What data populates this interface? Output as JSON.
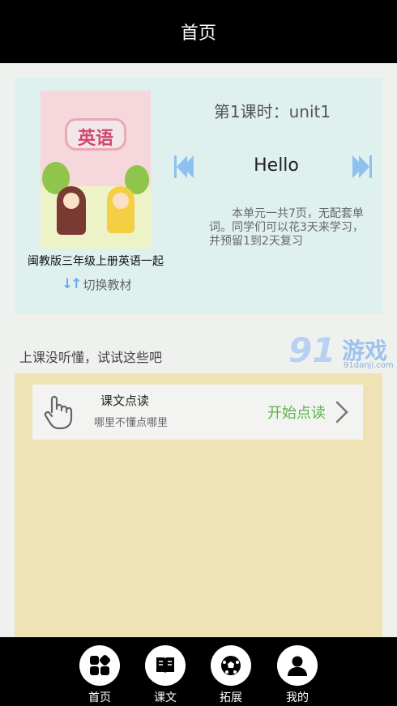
{
  "header": {
    "title": "首页"
  },
  "book": {
    "cover_title": "英语",
    "name": "闽教版三年级上册英语一起",
    "switch_label": "切换教材"
  },
  "lesson": {
    "title": "第1课时：unit1",
    "unit_name": "Hello",
    "description": "本单元一共7页，无配套单词。同学们可以花3天来学习，并预留1到2天复习"
  },
  "tip": {
    "text": "上课没听懂，试试这些吧"
  },
  "read_item": {
    "title": "课文点读",
    "subtitle": "哪里不懂点哪里",
    "action": "开始点读"
  },
  "nav": {
    "items": [
      {
        "label": "首页",
        "icon": "grid-icon"
      },
      {
        "label": "课文",
        "icon": "book-icon"
      },
      {
        "label": "拓展",
        "icon": "ball-icon"
      },
      {
        "label": "我的",
        "icon": "user-icon"
      }
    ]
  },
  "watermark": {
    "logo": "91",
    "text": "游戏",
    "url": "91danji.com"
  },
  "colors": {
    "topbar": "#000000",
    "card_bg": "#dff1ee",
    "panel_bg": "#efe3b6",
    "accent_green": "#5cb549",
    "arrow_blue": "#8ec1ee"
  }
}
